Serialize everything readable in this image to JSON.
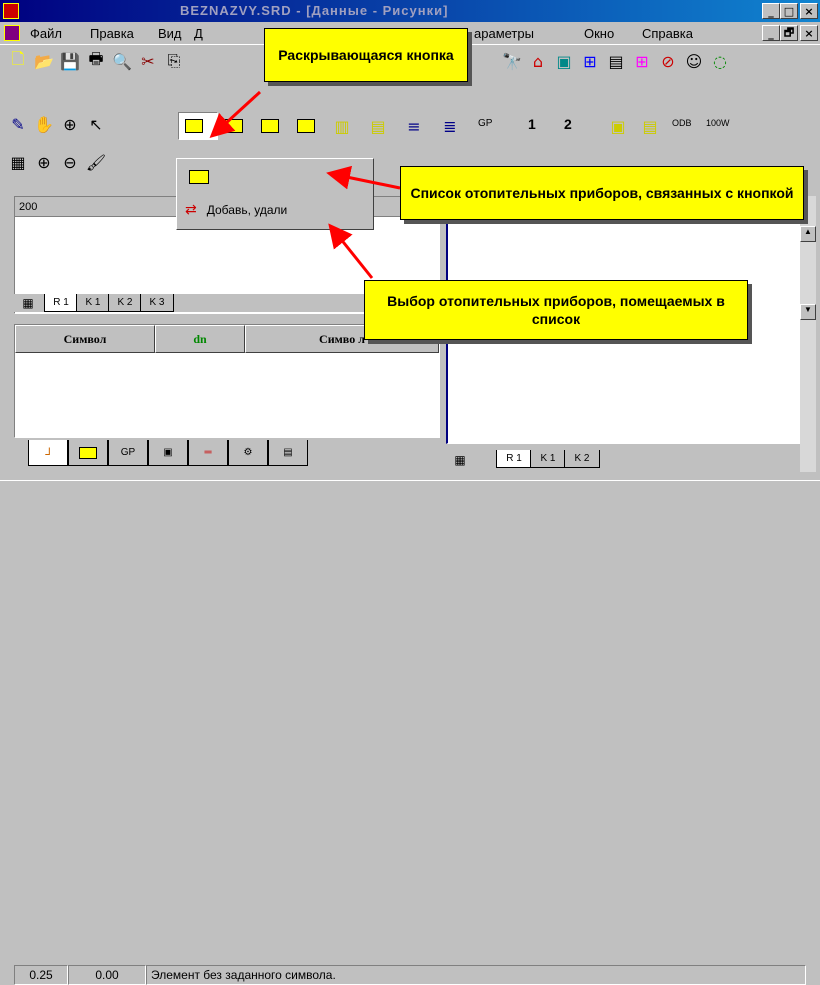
{
  "window": {
    "title": "BEZNAZVY.SRD - [Данные - Рисунки]",
    "min_label": "_",
    "max_label": "□",
    "close_label": "×",
    "doc_min": "_",
    "doc_restore": "🗗",
    "doc_close": "×"
  },
  "menu": {
    "items": [
      "Файл",
      "Правка",
      "Вид",
      "Д",
      "араметры",
      "Окно",
      "Справка"
    ]
  },
  "callouts": {
    "dropdown_button": "Раскрывающаяся кнопка",
    "list_desc": "Список отопительных приборов, связанных с кнопкой",
    "select_desc": "Выбор отопительных приборов, помещаемых в список"
  },
  "dropdown": {
    "add_remove_label": "Добавь, удали"
  },
  "ruler": {
    "value": "200"
  },
  "left_pane_tabs": [
    "R 1",
    "K 1",
    "K 2",
    "K 3"
  ],
  "table": {
    "headers": [
      "Символ",
      "dn",
      "Симво л"
    ]
  },
  "right_pane_tabs": [
    "R 1",
    "K 1",
    "K 2"
  ],
  "toolbar3_labels": {
    "gp": "GP",
    "one": "1",
    "two": "2",
    "odb": "ODB",
    "w100": "100W"
  },
  "status": {
    "x": "0.25",
    "y": "0.00",
    "message": "Элемент без заданного символа."
  },
  "colors": {
    "title": "#000080",
    "callout": "#ffff00",
    "arrow": "#ff0000"
  }
}
